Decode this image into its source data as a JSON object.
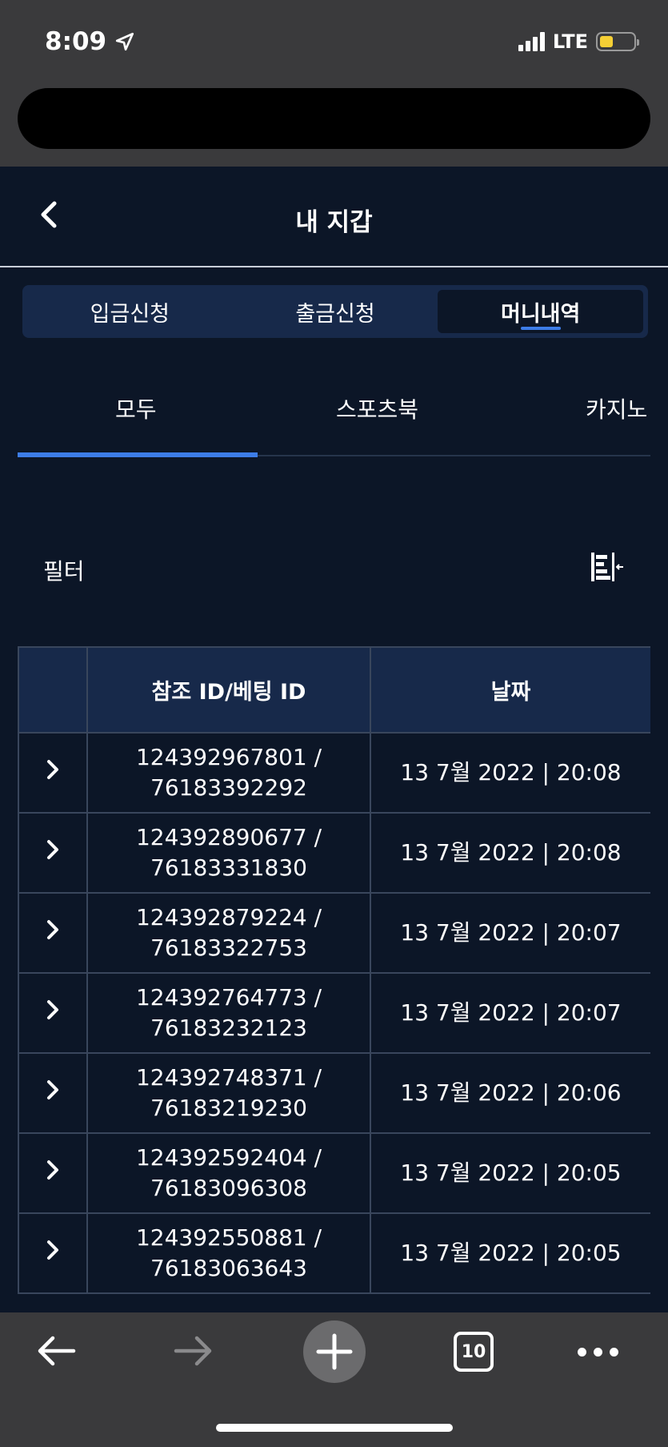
{
  "status": {
    "time": "8:09",
    "network": "LTE",
    "battery_color": "#f5cf35"
  },
  "header": {
    "title": "내 지갑",
    "back_icon": "chevron-left-icon"
  },
  "segments": [
    {
      "label": "입금신청",
      "active": false
    },
    {
      "label": "출금신청",
      "active": false
    },
    {
      "label": "머니내역",
      "active": true
    }
  ],
  "sub_tabs": [
    {
      "label": "모두",
      "active": true
    },
    {
      "label": "스포츠북",
      "active": false
    },
    {
      "label": "카지노",
      "active": false
    }
  ],
  "filter": {
    "label": "필터",
    "icon": "filter-collapse-icon"
  },
  "table": {
    "headers": [
      "",
      "참조 ID/베팅 ID",
      "날짜"
    ],
    "rows": [
      {
        "ref_id": "124392967801 /",
        "bet_id": "76183392292",
        "date": "13 7월 2022 | 20:08"
      },
      {
        "ref_id": "124392890677 /",
        "bet_id": "76183331830",
        "date": "13 7월 2022 | 20:08"
      },
      {
        "ref_id": "124392879224 /",
        "bet_id": "76183322753",
        "date": "13 7월 2022 | 20:07"
      },
      {
        "ref_id": "124392764773 /",
        "bet_id": "76183232123",
        "date": "13 7월 2022 | 20:07"
      },
      {
        "ref_id": "124392748371 /",
        "bet_id": "76183219230",
        "date": "13 7월 2022 | 20:06"
      },
      {
        "ref_id": "124392592404 /",
        "bet_id": "76183096308",
        "date": "13 7월 2022 | 20:05"
      },
      {
        "ref_id": "124392550881 /",
        "bet_id": "76183063643",
        "date": "13 7월 2022 | 20:05"
      }
    ]
  },
  "browser": {
    "tab_count": "10"
  },
  "colors": {
    "background": "#0c1627",
    "header_fill": "#17294a",
    "accent": "#3d7de8",
    "border": "#39465c"
  }
}
